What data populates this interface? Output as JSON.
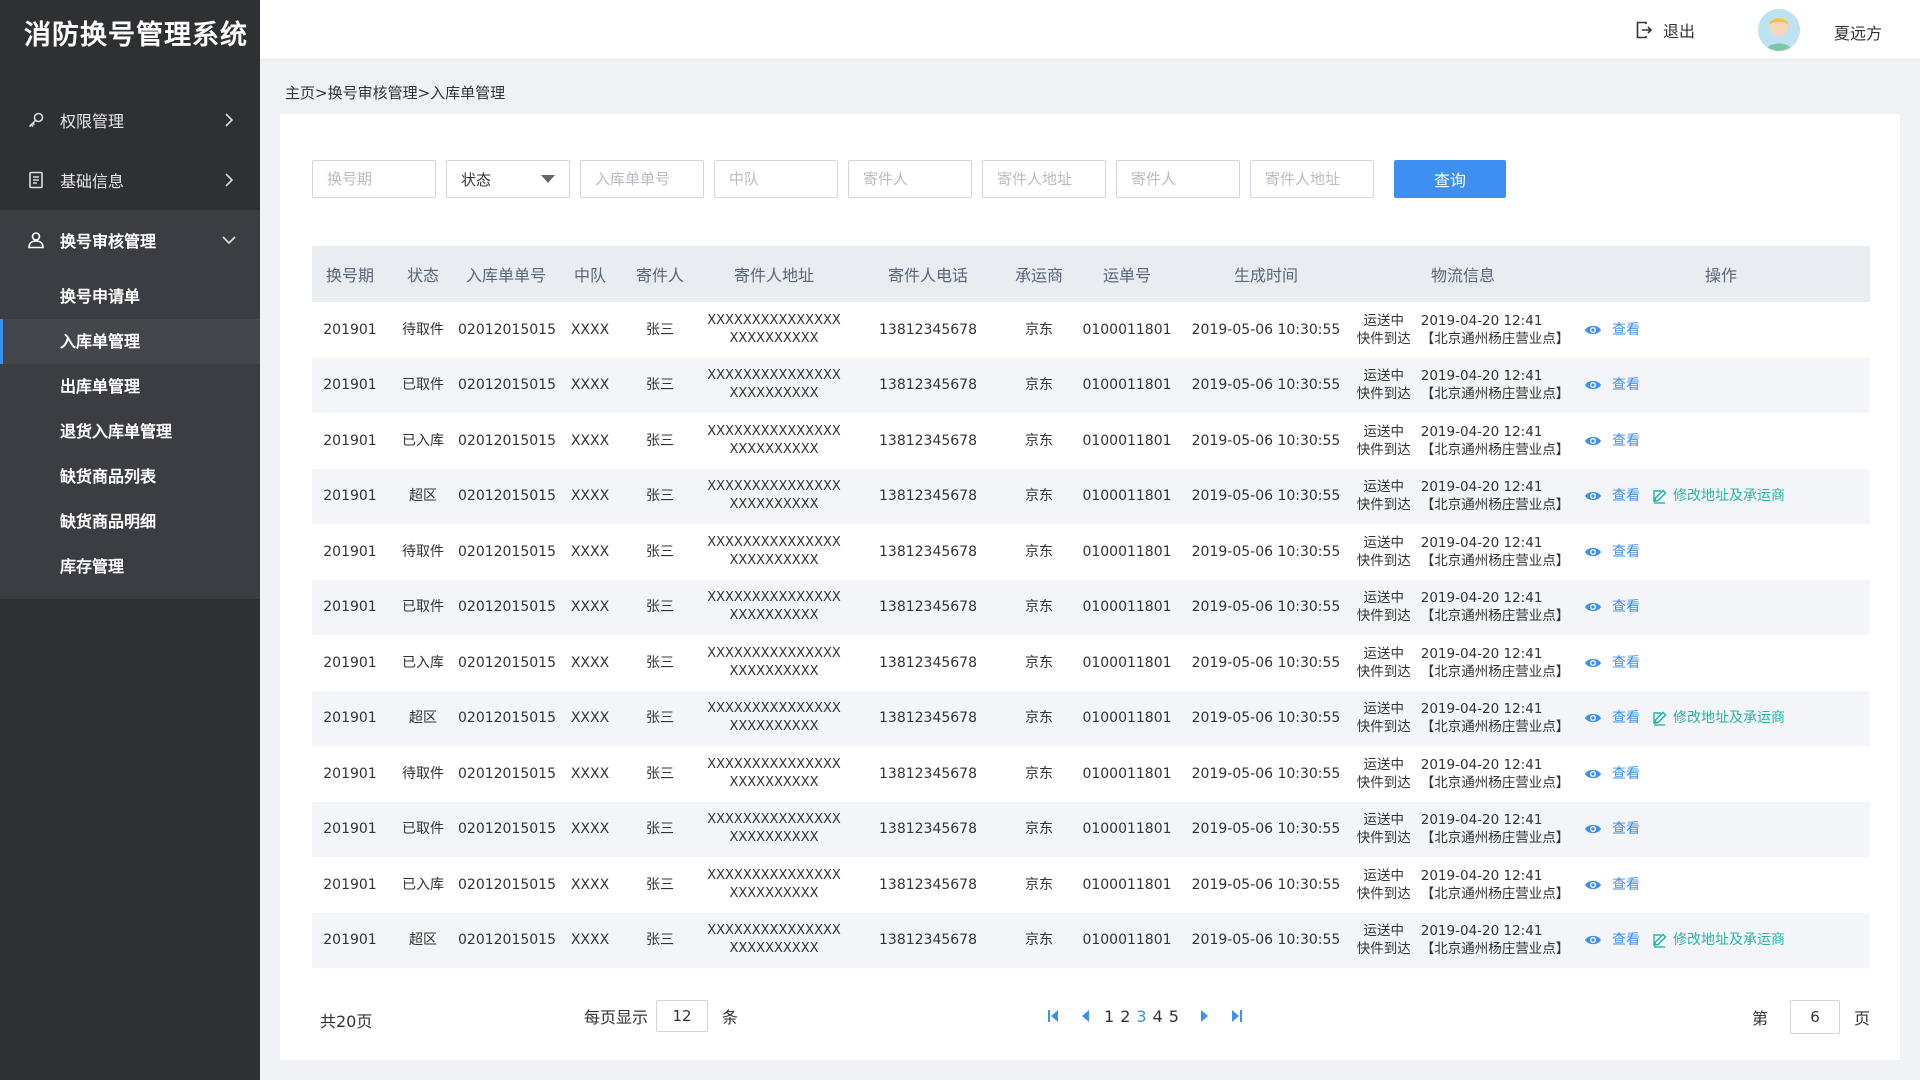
{
  "app": {
    "title": "消防换号管理系统"
  },
  "header": {
    "logout_label": "退出",
    "user_name": "夏远方"
  },
  "sidebar": {
    "items": [
      {
        "label": "权限管理",
        "icon": "key-icon"
      },
      {
        "label": "基础信息",
        "icon": "document-icon"
      },
      {
        "label": "换号审核管理",
        "icon": "user-icon"
      }
    ],
    "sub_items": [
      {
        "label": "换号申请单"
      },
      {
        "label": "入库单管理"
      },
      {
        "label": "出库单管理"
      },
      {
        "label": "退货入库单管理"
      },
      {
        "label": "缺货商品列表"
      },
      {
        "label": "缺货商品明细"
      },
      {
        "label": "库存管理"
      }
    ]
  },
  "breadcrumb": "主页>换号审核管理>入库单管理",
  "filters": {
    "period_placeholder": "换号期",
    "status_value": "状态",
    "order_no_placeholder": "入库单单号",
    "team_placeholder": "中队",
    "sender1_placeholder": "寄件人",
    "sender_addr1_placeholder": "寄件人地址",
    "sender2_placeholder": "寄件人",
    "sender_addr2_placeholder": "寄件人地址",
    "query_label": "查询"
  },
  "table": {
    "headers": [
      "换号期",
      "状态",
      "入库单单号",
      "中队",
      "寄件人",
      "寄件人地址",
      "寄件人电话",
      "承运商",
      "运单号",
      "生成时间",
      "物流信息",
      "操作"
    ],
    "view_label": "查看",
    "edit_label": "修改地址及承运商",
    "rows": [
      {
        "period": "201901",
        "status": "待取件",
        "order_no": "02012015015",
        "team": "XXXX",
        "sender": "张三",
        "addr1": "XXXXXXXXXXXXXXX",
        "addr2": "XXXXXXXXXX",
        "phone": "13812345678",
        "carrier": "京东",
        "waybill": "0100011801",
        "time": "2019-05-06 10:30:55",
        "logi_status1": "运送中",
        "logi_status2": "快件到达",
        "logi_time": "2019-04-20 12:41",
        "logi_place": "【北京通州杨庄营业点】",
        "editable": false
      },
      {
        "period": "201901",
        "status": "已取件",
        "order_no": "02012015015",
        "team": "XXXX",
        "sender": "张三",
        "addr1": "XXXXXXXXXXXXXXX",
        "addr2": "XXXXXXXXXX",
        "phone": "13812345678",
        "carrier": "京东",
        "waybill": "0100011801",
        "time": "2019-05-06 10:30:55",
        "logi_status1": "运送中",
        "logi_status2": "快件到达",
        "logi_time": "2019-04-20 12:41",
        "logi_place": "【北京通州杨庄营业点】",
        "editable": false
      },
      {
        "period": "201901",
        "status": "已入库",
        "order_no": "02012015015",
        "team": "XXXX",
        "sender": "张三",
        "addr1": "XXXXXXXXXXXXXXX",
        "addr2": "XXXXXXXXXX",
        "phone": "13812345678",
        "carrier": "京东",
        "waybill": "0100011801",
        "time": "2019-05-06 10:30:55",
        "logi_status1": "运送中",
        "logi_status2": "快件到达",
        "logi_time": "2019-04-20 12:41",
        "logi_place": "【北京通州杨庄营业点】",
        "editable": false
      },
      {
        "period": "201901",
        "status": "超区",
        "order_no": "02012015015",
        "team": "XXXX",
        "sender": "张三",
        "addr1": "XXXXXXXXXXXXXXX",
        "addr2": "XXXXXXXXXX",
        "phone": "13812345678",
        "carrier": "京东",
        "waybill": "0100011801",
        "time": "2019-05-06 10:30:55",
        "logi_status1": "运送中",
        "logi_status2": "快件到达",
        "logi_time": "2019-04-20 12:41",
        "logi_place": "【北京通州杨庄营业点】",
        "editable": true
      },
      {
        "period": "201901",
        "status": "待取件",
        "order_no": "02012015015",
        "team": "XXXX",
        "sender": "张三",
        "addr1": "XXXXXXXXXXXXXXX",
        "addr2": "XXXXXXXXXX",
        "phone": "13812345678",
        "carrier": "京东",
        "waybill": "0100011801",
        "time": "2019-05-06 10:30:55",
        "logi_status1": "运送中",
        "logi_status2": "快件到达",
        "logi_time": "2019-04-20 12:41",
        "logi_place": "【北京通州杨庄营业点】",
        "editable": false
      },
      {
        "period": "201901",
        "status": "已取件",
        "order_no": "02012015015",
        "team": "XXXX",
        "sender": "张三",
        "addr1": "XXXXXXXXXXXXXXX",
        "addr2": "XXXXXXXXXX",
        "phone": "13812345678",
        "carrier": "京东",
        "waybill": "0100011801",
        "time": "2019-05-06 10:30:55",
        "logi_status1": "运送中",
        "logi_status2": "快件到达",
        "logi_time": "2019-04-20 12:41",
        "logi_place": "【北京通州杨庄营业点】",
        "editable": false
      },
      {
        "period": "201901",
        "status": "已入库",
        "order_no": "02012015015",
        "team": "XXXX",
        "sender": "张三",
        "addr1": "XXXXXXXXXXXXXXX",
        "addr2": "XXXXXXXXXX",
        "phone": "13812345678",
        "carrier": "京东",
        "waybill": "0100011801",
        "time": "2019-05-06 10:30:55",
        "logi_status1": "运送中",
        "logi_status2": "快件到达",
        "logi_time": "2019-04-20 12:41",
        "logi_place": "【北京通州杨庄营业点】",
        "editable": false
      },
      {
        "period": "201901",
        "status": "超区",
        "order_no": "02012015015",
        "team": "XXXX",
        "sender": "张三",
        "addr1": "XXXXXXXXXXXXXXX",
        "addr2": "XXXXXXXXXX",
        "phone": "13812345678",
        "carrier": "京东",
        "waybill": "0100011801",
        "time": "2019-05-06 10:30:55",
        "logi_status1": "运送中",
        "logi_status2": "快件到达",
        "logi_time": "2019-04-20 12:41",
        "logi_place": "【北京通州杨庄营业点】",
        "editable": true
      },
      {
        "period": "201901",
        "status": "待取件",
        "order_no": "02012015015",
        "team": "XXXX",
        "sender": "张三",
        "addr1": "XXXXXXXXXXXXXXX",
        "addr2": "XXXXXXXXXX",
        "phone": "13812345678",
        "carrier": "京东",
        "waybill": "0100011801",
        "time": "2019-05-06 10:30:55",
        "logi_status1": "运送中",
        "logi_status2": "快件到达",
        "logi_time": "2019-04-20 12:41",
        "logi_place": "【北京通州杨庄营业点】",
        "editable": false
      },
      {
        "period": "201901",
        "status": "已取件",
        "order_no": "02012015015",
        "team": "XXXX",
        "sender": "张三",
        "addr1": "XXXXXXXXXXXXXXX",
        "addr2": "XXXXXXXXXX",
        "phone": "13812345678",
        "carrier": "京东",
        "waybill": "0100011801",
        "time": "2019-05-06 10:30:55",
        "logi_status1": "运送中",
        "logi_status2": "快件到达",
        "logi_time": "2019-04-20 12:41",
        "logi_place": "【北京通州杨庄营业点】",
        "editable": false
      },
      {
        "period": "201901",
        "status": "已入库",
        "order_no": "02012015015",
        "team": "XXXX",
        "sender": "张三",
        "addr1": "XXXXXXXXXXXXXXX",
        "addr2": "XXXXXXXXXX",
        "phone": "13812345678",
        "carrier": "京东",
        "waybill": "0100011801",
        "time": "2019-05-06 10:30:55",
        "logi_status1": "运送中",
        "logi_status2": "快件到达",
        "logi_time": "2019-04-20 12:41",
        "logi_place": "【北京通州杨庄营业点】",
        "editable": false
      },
      {
        "period": "201901",
        "status": "超区",
        "order_no": "02012015015",
        "team": "XXXX",
        "sender": "张三",
        "addr1": "XXXXXXXXXXXXXXX",
        "addr2": "XXXXXXXXXX",
        "phone": "13812345678",
        "carrier": "京东",
        "waybill": "0100011801",
        "time": "2019-05-06 10:30:55",
        "logi_status1": "运送中",
        "logi_status2": "快件到达",
        "logi_time": "2019-04-20 12:41",
        "logi_place": "【北京通州杨庄营业点】",
        "editable": true
      }
    ]
  },
  "pagination": {
    "total_label": "共20页",
    "per_page_label": "每页显示",
    "per_page_value": "12",
    "per_page_unit": "条",
    "pages": [
      "1",
      "2",
      "3",
      "4",
      "5"
    ],
    "current_page": "3",
    "goto_prefix": "第",
    "goto_value": "6",
    "goto_suffix": "页"
  },
  "colors": {
    "accent": "#3d8ff2",
    "edit": "#26b5a5",
    "sidebar_bg": "#2f3034"
  }
}
